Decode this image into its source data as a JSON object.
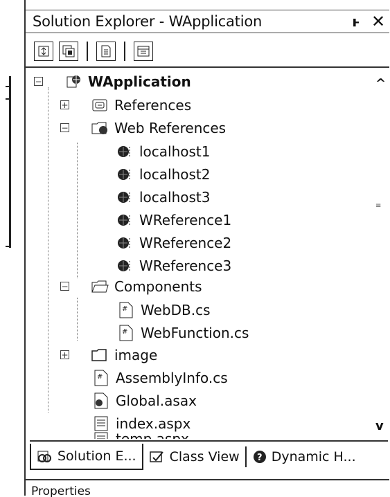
{
  "window": {
    "title": "Solution Explorer - WApplication",
    "pin_glyph": "ͱ",
    "close_glyph": "✕"
  },
  "toolbar": {
    "buttons": [
      {
        "name": "refresh-icon"
      },
      {
        "name": "show-all-files-icon"
      },
      {
        "name": "properties-icon"
      },
      {
        "name": "view-designer-icon"
      }
    ]
  },
  "tree": {
    "root": "WApplication",
    "references": "References",
    "web_references": "Web References",
    "web_reference_items": [
      "localhost1",
      "localhost2",
      "localhost3",
      "WReference1",
      "WReference2",
      "WReference3"
    ],
    "components": "Components",
    "component_items": [
      "WebDB.cs",
      "WebFunction.cs"
    ],
    "image_folder": "image",
    "files": [
      "AssemblyInfo.cs",
      "Global.asax",
      "index.aspx",
      "temp.aspx"
    ]
  },
  "tabs": [
    "Solution E...",
    "Class View",
    "Dynamic H..."
  ],
  "bottom_panel": {
    "title": "Properties"
  }
}
